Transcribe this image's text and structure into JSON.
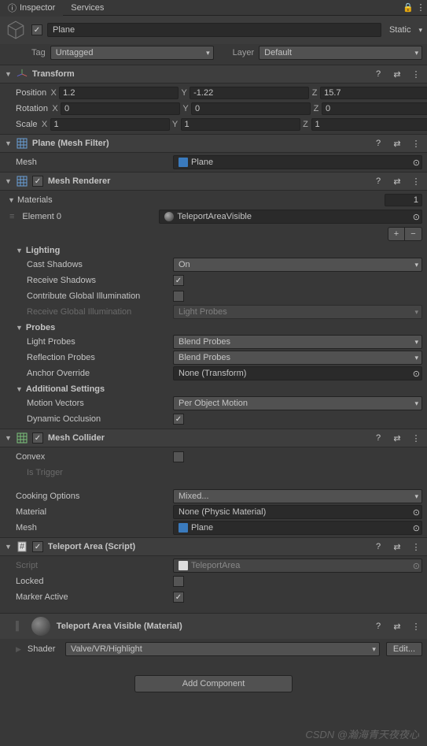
{
  "tabs": {
    "inspector": "Inspector",
    "services": "Services"
  },
  "gameObject": {
    "name": "Plane",
    "active": true,
    "staticLabel": "Static",
    "tagLabel": "Tag",
    "tag": "Untagged",
    "layerLabel": "Layer",
    "layer": "Default"
  },
  "transform": {
    "title": "Transform",
    "position": {
      "label": "Position",
      "x": "1.2",
      "y": "-1.22",
      "z": "15.7"
    },
    "rotation": {
      "label": "Rotation",
      "x": "0",
      "y": "0",
      "z": "0"
    },
    "scale": {
      "label": "Scale",
      "x": "1",
      "y": "1",
      "z": "1"
    },
    "axes": {
      "x": "X",
      "y": "Y",
      "z": "Z"
    }
  },
  "meshFilter": {
    "title": "Plane (Mesh Filter)",
    "meshLabel": "Mesh",
    "mesh": "Plane"
  },
  "meshRenderer": {
    "title": "Mesh Renderer",
    "enabled": true,
    "materials": {
      "label": "Materials",
      "size": "1",
      "element0Label": "Element 0",
      "element0": "TeleportAreaVisible"
    },
    "lighting": {
      "label": "Lighting",
      "castShadowsLabel": "Cast Shadows",
      "castShadows": "On",
      "receiveShadowsLabel": "Receive Shadows",
      "receiveShadows": true,
      "contribGILabel": "Contribute Global Illumination",
      "contribGI": false,
      "receiveGILabel": "Receive Global Illumination",
      "receiveGI": "Light Probes"
    },
    "probes": {
      "label": "Probes",
      "lightProbesLabel": "Light Probes",
      "lightProbes": "Blend Probes",
      "reflectionProbesLabel": "Reflection Probes",
      "reflectionProbes": "Blend Probes",
      "anchorOverrideLabel": "Anchor Override",
      "anchorOverride": "None (Transform)"
    },
    "additional": {
      "label": "Additional Settings",
      "motionVectorsLabel": "Motion Vectors",
      "motionVectors": "Per Object Motion",
      "dynamicOcclusionLabel": "Dynamic Occlusion",
      "dynamicOcclusion": true
    }
  },
  "meshCollider": {
    "title": "Mesh Collider",
    "enabled": true,
    "convexLabel": "Convex",
    "convex": false,
    "isTriggerLabel": "Is Trigger",
    "cookingOptionsLabel": "Cooking Options",
    "cookingOptions": "Mixed...",
    "materialLabel": "Material",
    "material": "None (Physic Material)",
    "meshLabel": "Mesh",
    "mesh": "Plane"
  },
  "teleportArea": {
    "title": "Teleport Area (Script)",
    "enabled": true,
    "scriptLabel": "Script",
    "script": "TeleportArea",
    "lockedLabel": "Locked",
    "locked": false,
    "markerActiveLabel": "Marker Active",
    "markerActive": true
  },
  "material": {
    "title": "Teleport Area Visible (Material)",
    "shaderLabel": "Shader",
    "shader": "Valve/VR/Highlight",
    "editBtn": "Edit..."
  },
  "addComponentBtn": "Add Component",
  "watermark": "CSDN @瀚海青天夜夜心"
}
